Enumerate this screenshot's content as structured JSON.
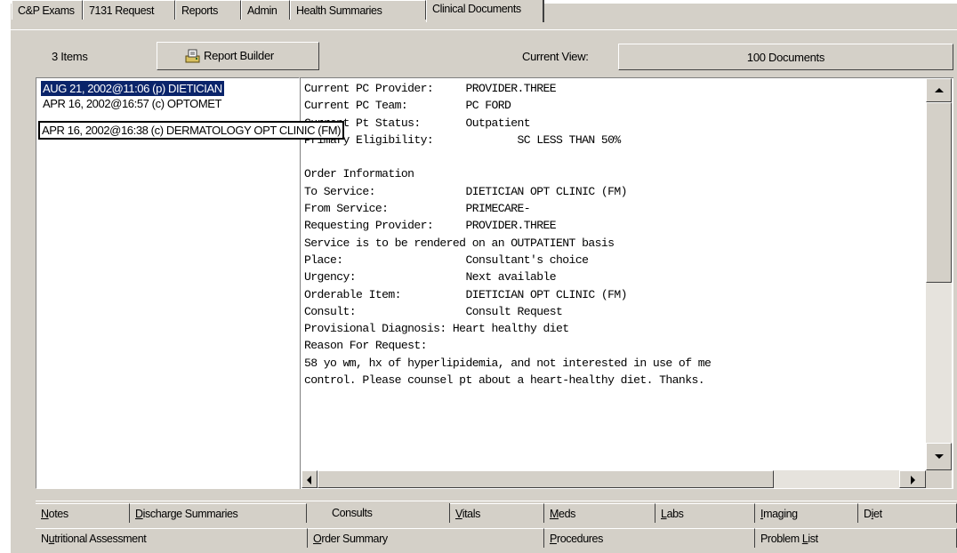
{
  "top_tabs": [
    "C&P Exams",
    "7131 Request",
    "Reports",
    "Admin",
    "Health Summaries",
    "Clinical Documents"
  ],
  "toolbar": {
    "items_count": "3 Items",
    "report_builder_label": "Report Builder",
    "current_view_label": "Current View:",
    "current_view_value": "100 Documents"
  },
  "document_list": [
    "AUG 21, 2002@11:06 (p) DIETICIAN",
    "APR 16, 2002@16:57 (c) OPTOMET",
    "APR 16, 2002@16:38 (c) DERMATOLOGY OPT CLINIC (FM)"
  ],
  "document_lines": [
    "Current PC Provider:     PROVIDER.THREE",
    "Current PC Team:         PC FORD",
    "Current Pt Status:       Outpatient",
    "Primary Eligibility:             SC LESS THAN 50%",
    "",
    "Order Information",
    "To Service:              DIETICIAN OPT CLINIC (FM)",
    "From Service:            PRIMECARE-",
    "Requesting Provider:     PROVIDER.THREE",
    "Service is to be rendered on an OUTPATIENT basis",
    "Place:                   Consultant's choice",
    "Urgency:                 Next available",
    "Orderable Item:          DIETICIAN OPT CLINIC (FM)",
    "Consult:                 Consult Request",
    "Provisional Diagnosis: Heart healthy diet",
    "Reason For Request:",
    "58 yo wm, hx of hyperlipidemia, and not interested in use of me",
    "control. Please counsel pt about a heart-healthy diet. Thanks."
  ],
  "bottom_tabs_row1": [
    {
      "pre": "",
      "u": "N",
      "post": "otes"
    },
    {
      "pre": "",
      "u": "D",
      "post": "ischarge Summaries"
    },
    {
      "pre": "Consults",
      "u": "",
      "post": ""
    },
    {
      "pre": "",
      "u": "V",
      "post": "itals"
    },
    {
      "pre": "",
      "u": "M",
      "post": "eds"
    },
    {
      "pre": "",
      "u": "L",
      "post": "abs"
    },
    {
      "pre": "",
      "u": "I",
      "post": "maging"
    },
    {
      "pre": "D",
      "u": "i",
      "post": "et"
    }
  ],
  "bottom_tabs_row2": [
    {
      "pre": "N",
      "u": "u",
      "post": "tritional Assessment"
    },
    {
      "pre": "",
      "u": "O",
      "post": "rder Summary"
    },
    {
      "pre": "",
      "u": "P",
      "post": "rocedures"
    },
    {
      "pre": "Problem ",
      "u": "L",
      "post": "ist"
    }
  ],
  "colors": {
    "window_bg": "#d4d0c8",
    "selection": "#0a246a",
    "scroll_track": "#e6e3dd"
  },
  "icons": [
    "report-builder-icon",
    "scroll-up-icon",
    "scroll-down-icon",
    "scroll-left-icon",
    "scroll-right-icon"
  ]
}
